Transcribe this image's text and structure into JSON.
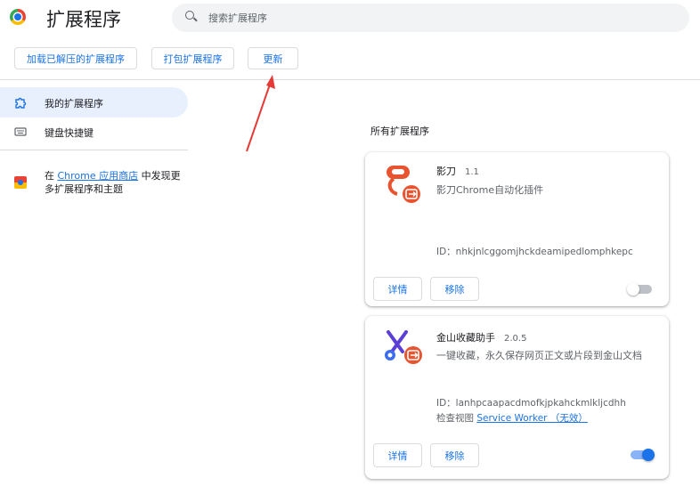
{
  "header": {
    "title": "扩展程序",
    "search_placeholder": "搜索扩展程序"
  },
  "toolbar": {
    "load_unpacked": "加载已解压的扩展程序",
    "pack": "打包扩展程序",
    "update": "更新"
  },
  "sidebar": {
    "items": [
      {
        "label": "我的扩展程序",
        "icon": "puzzle-icon",
        "active": true
      },
      {
        "label": "键盘快捷键",
        "icon": "keyboard-icon",
        "active": false
      }
    ],
    "store_prefix": "在 ",
    "store_link": "Chrome 应用商店",
    "store_suffix": " 中发现更多扩展程序和主题"
  },
  "main": {
    "section_title": "所有扩展程序",
    "extensions": [
      {
        "name": "影刀",
        "version": "1.1",
        "description": "影刀Chrome自动化插件",
        "id": "ID：nhkjnlcggomjhckdeamipedlomphkepc",
        "details_label": "详情",
        "remove_label": "移除",
        "enabled": false,
        "icon": "yingdao-icon"
      },
      {
        "name": "金山收藏助手",
        "version": "2.0.5",
        "description": "一键收藏，永久保存网页正文或片段到金山文档",
        "id": "ID：lanhpcaapacdmofkjpkahckmlkljcdhh",
        "inspect_prefix": "检查视图 ",
        "inspect_link": "Service Worker （无效）",
        "details_label": "详情",
        "remove_label": "移除",
        "enabled": true,
        "icon": "kingsoft-scissors-icon"
      }
    ]
  },
  "colors": {
    "accent": "#1a73e8",
    "active_bg": "#e8f0fe",
    "extension_badge": "#e8542f",
    "annotation_arrow": "#e53935"
  }
}
